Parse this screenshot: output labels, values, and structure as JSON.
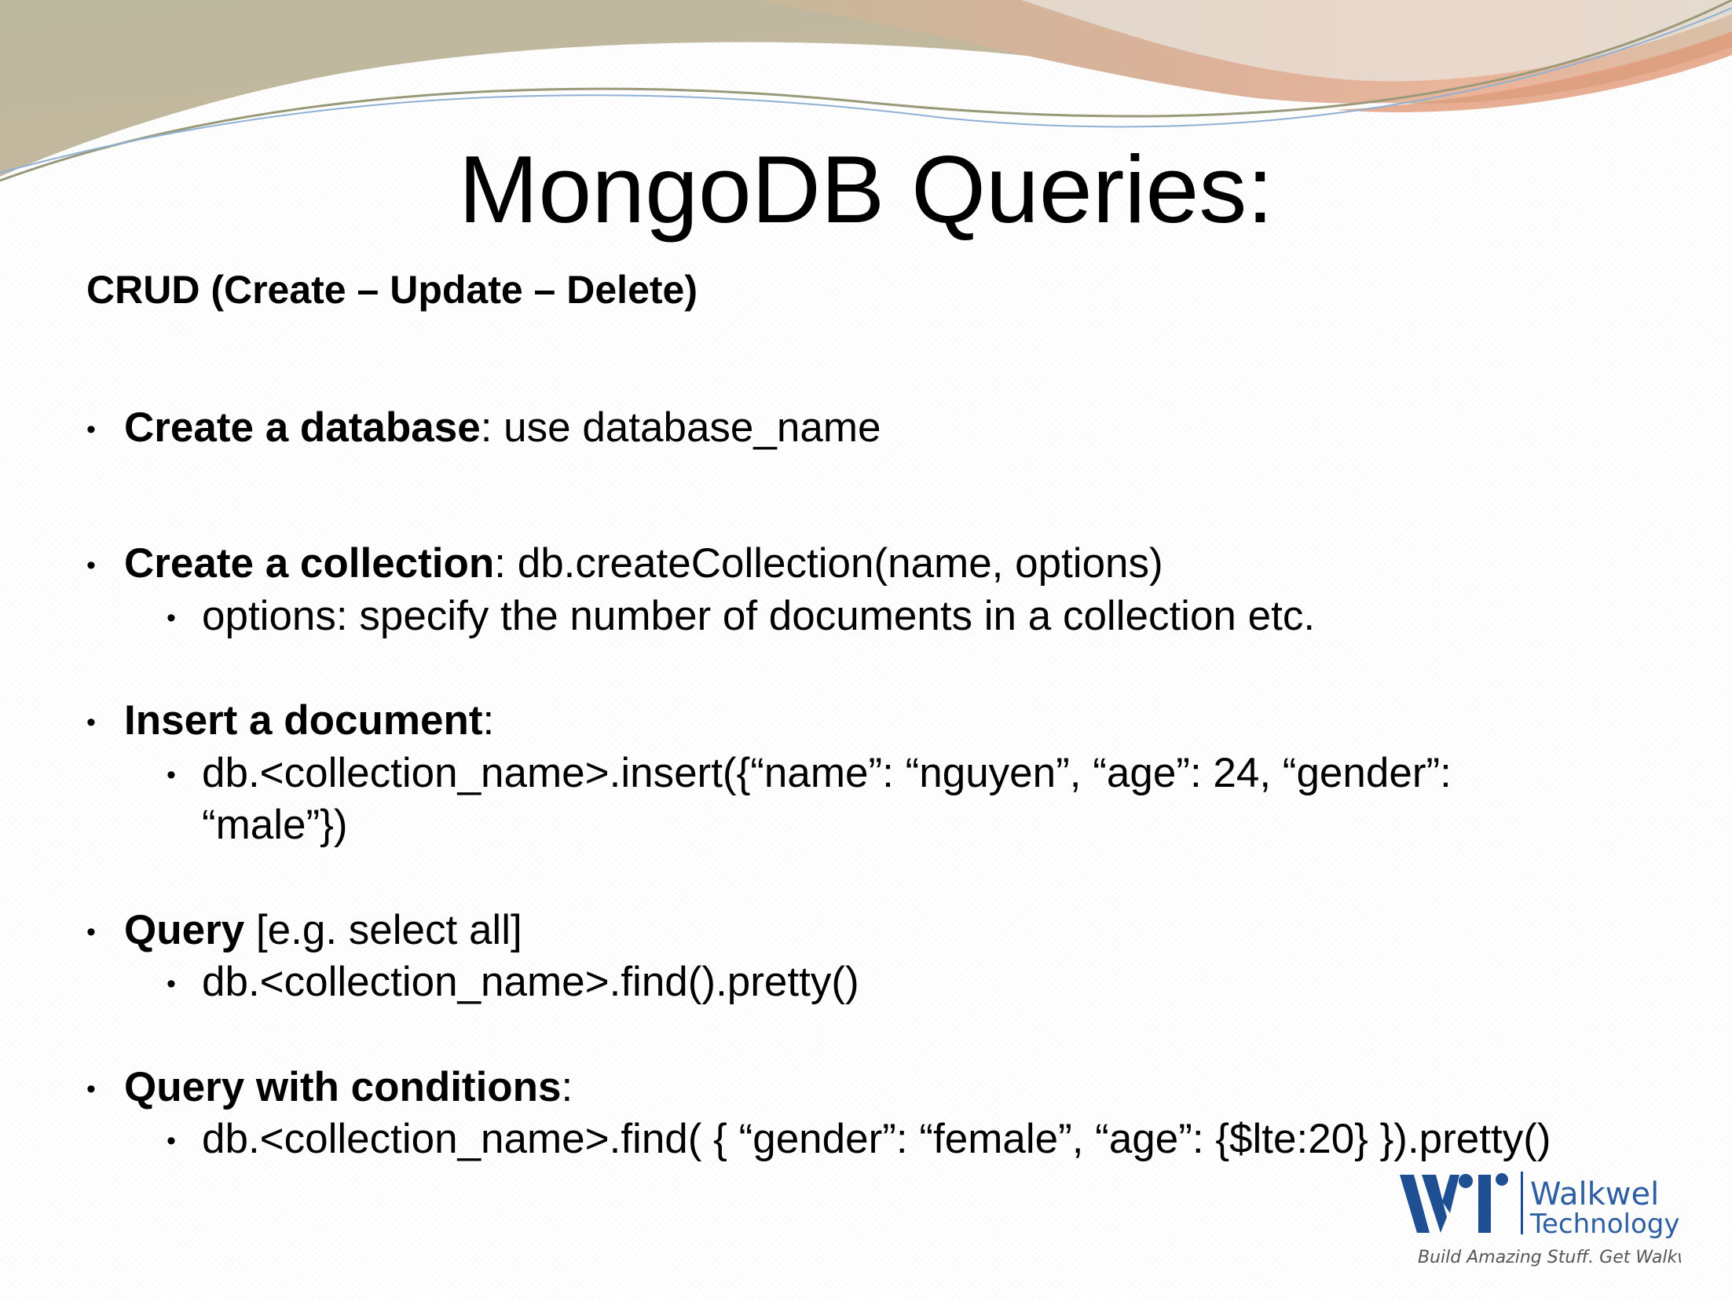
{
  "slide": {
    "title": "MongoDB Queries:",
    "subtitle": "CRUD (Create – Update – Delete)",
    "bullets": [
      {
        "bold": "Create a database",
        "rest": ": use database_name"
      },
      {
        "bold": "Create a collection",
        "rest": ": db.createCollection(name, options)",
        "sub": "options: specify the number of documents in a collection etc."
      },
      {
        "bold": "Insert a document",
        "rest": ":",
        "sub": "db.<collection_name>.insert({“name”: “nguyen”, “age”: 24, “gender”: “male”})"
      },
      {
        "bold": "Query",
        "rest": " [e.g. select all]",
        "sub": "db.<collection_name>.find().pretty()"
      },
      {
        "bold": "Query with conditions",
        "rest": ":",
        "sub": "db.<collection_name>.find( { “gender”: “female”, “age”: {$lte:20} }).pretty()"
      }
    ]
  },
  "logo": {
    "name_line1": "Walkwel",
    "name_line2": "Technology",
    "tagline": "Build Amazing Stuff. Get Walkwel"
  },
  "colors": {
    "logo_blue": "#2e5fa1",
    "wave_peach": "#e8a88a",
    "wave_olive": "#bcb28c"
  }
}
